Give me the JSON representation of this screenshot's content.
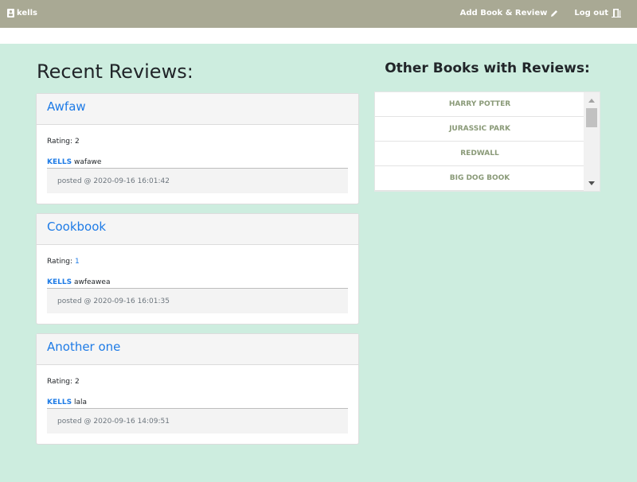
{
  "nav": {
    "username": "kells",
    "add_label": "Add Book & Review",
    "logout_label": "Log out"
  },
  "recent": {
    "heading": "Recent Reviews:",
    "reviews": [
      {
        "title": "Awfaw",
        "rating_label": "Rating:",
        "rating": "2",
        "user": "KELLS",
        "text": "wafawe",
        "posted": "posted @ 2020-09-16 16:01:42"
      },
      {
        "title": "Cookbook",
        "rating_label": "Rating:",
        "rating": "1",
        "user": "KELLS",
        "text": "awfeawea",
        "posted": "posted @ 2020-09-16 16:01:35"
      },
      {
        "title": "Another one",
        "rating_label": "Rating:",
        "rating": "2",
        "user": "KELLS",
        "text": "lala",
        "posted": "posted @ 2020-09-16 14:09:51"
      }
    ]
  },
  "other": {
    "heading": "Other Books with Reviews:",
    "books": [
      "HARRY POTTER",
      "JURASSIC PARK",
      "REDWALL",
      "BIG DOG BOOK"
    ]
  },
  "colors": {
    "navbar": "#a9a994",
    "page_bg": "#cdeddf",
    "link_blue": "#1e7be6",
    "book_text": "#8a9a78"
  },
  "icons": {
    "user": "user-icon",
    "add": "pencil-icon",
    "logout": "door-exit-icon",
    "scroll_up": "triangle-up-icon",
    "scroll_down": "triangle-down-icon"
  }
}
